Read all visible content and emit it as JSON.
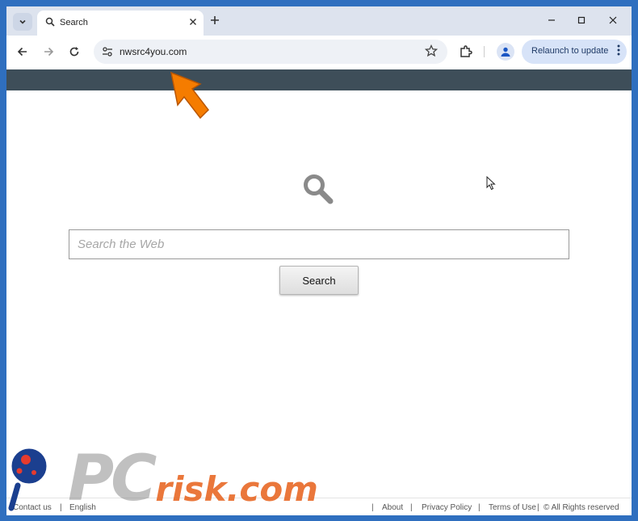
{
  "browser": {
    "tab": {
      "title": "Search"
    },
    "address": {
      "url": "nwsrc4you.com"
    },
    "relaunch_label": "Relaunch to update",
    "icons": {
      "tab_search": "chevron-down-icon",
      "tab_favicon": "search-icon",
      "tab_close": "close-icon",
      "new_tab": "plus-icon",
      "minimize": "minimize-icon",
      "maximize": "maximize-icon",
      "close_window": "close-icon",
      "back": "arrow-left-icon",
      "forward": "arrow-right-icon",
      "reload": "reload-icon",
      "site_info": "tune-icon",
      "bookmark": "star-icon",
      "extensions": "puzzle-icon",
      "profile": "person-icon",
      "menu": "more-vertical-icon"
    }
  },
  "page": {
    "header_bar_color": "#3e4e59",
    "search": {
      "placeholder": "Search the Web",
      "button_label": "Search"
    },
    "footer": {
      "contact": "Contact us",
      "language": "English",
      "about": "About",
      "privacy": "Privacy Policy",
      "terms": "Terms of Use",
      "rights": "© All Rights reserved",
      "separator": "|"
    }
  },
  "watermark": {
    "brand_pc": "PC",
    "brand_rest": "risk.com",
    "accent_color": "#e65f19"
  },
  "annotation": {
    "arrow_color": "#f57c00"
  }
}
